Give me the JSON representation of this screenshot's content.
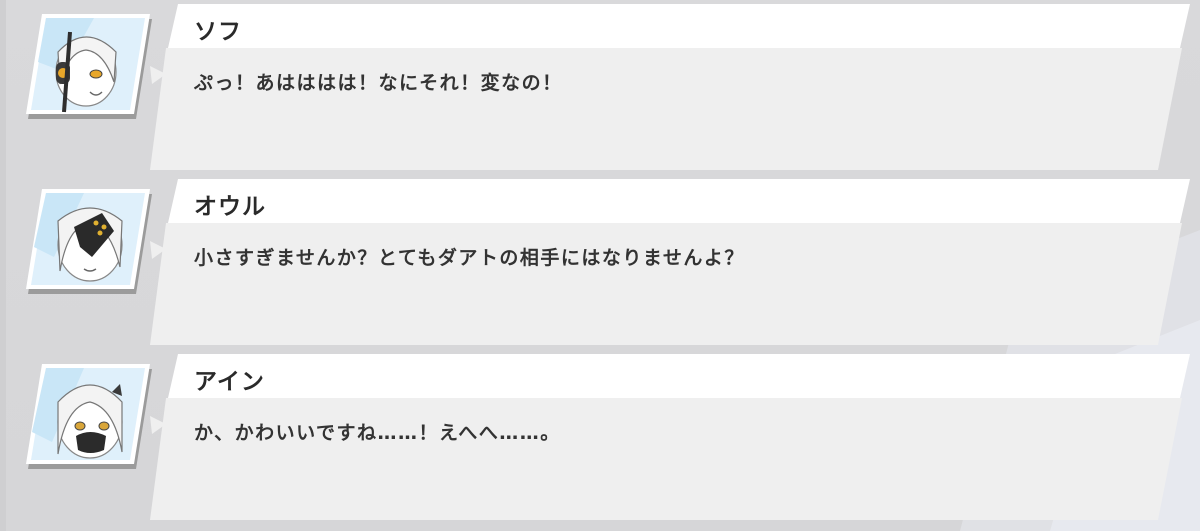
{
  "messages": [
    {
      "speaker": "ソフ",
      "text": "ぷっ！あはははは！なにそれ！変なの！",
      "avatar": "sofu-portrait",
      "eye_color": "#e8a72a"
    },
    {
      "speaker": "オウル",
      "text": "小さすぎませんか？とてもダアトの相手にはなりませんよ？",
      "avatar": "owl-portrait",
      "eye_color": "#e0b030"
    },
    {
      "speaker": "アイン",
      "text": "か、かわいいですね……！えへへ……。",
      "avatar": "ain-portrait",
      "eye_color": "#d9a63a"
    }
  ],
  "colors": {
    "background": "#d7d7d9",
    "bubble_body": "#efefef",
    "name_bar": "#ffffff",
    "avatar_frame_bg": "#dff0fb"
  }
}
